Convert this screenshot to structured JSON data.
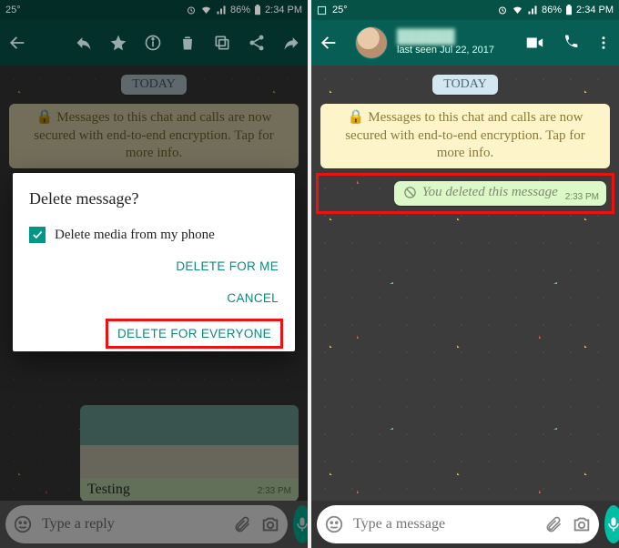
{
  "left": {
    "status": {
      "temp": "25°",
      "battery": "86%",
      "time": "2:34 PM"
    },
    "date_pill": "TODAY",
    "encryption_text": "Messages to this chat and calls are now secured with end-to-end encryption. Tap for more info.",
    "testing": {
      "caption": "Testing",
      "time": "2:33 PM"
    },
    "dialog": {
      "title": "Delete message?",
      "checkbox_label": "Delete media from my phone",
      "btn_me": "DELETE FOR ME",
      "btn_cancel": "CANCEL",
      "btn_everyone": "DELETE FOR EVERYONE"
    },
    "input_placeholder": "Type a reply"
  },
  "right": {
    "status": {
      "temp": "25°",
      "battery": "86%",
      "time": "2:34 PM"
    },
    "contact": {
      "name": "██████",
      "last_seen": "last seen Jul 22, 2017"
    },
    "date_pill": "TODAY",
    "encryption_text": "Messages to this chat and calls are now secured with end-to-end encryption. Tap for more info.",
    "deleted": {
      "text": "You deleted this message",
      "time": "2:33 PM"
    },
    "input_placeholder": "Type a message"
  }
}
